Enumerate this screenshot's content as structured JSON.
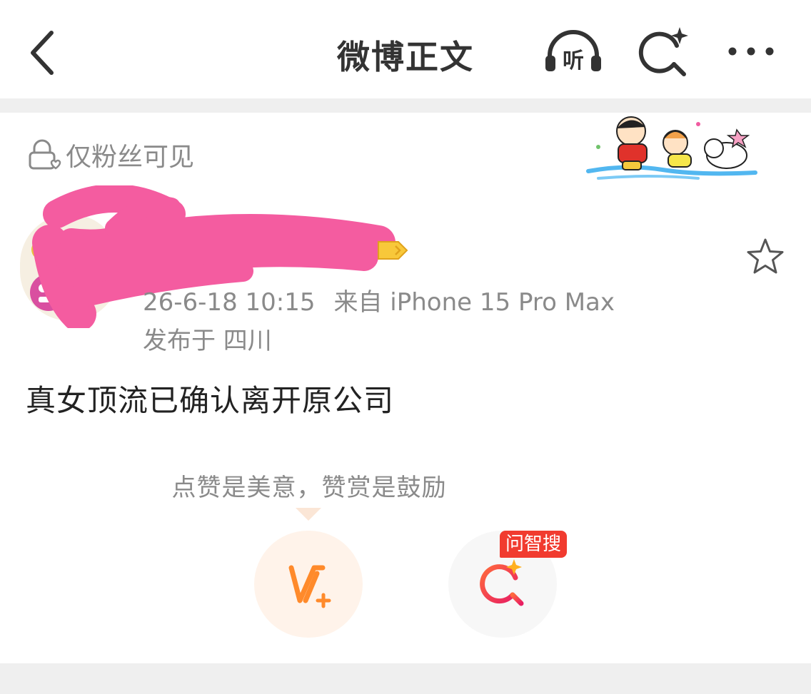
{
  "header": {
    "title": "微博正文",
    "listen_label": "听"
  },
  "post": {
    "visibility": "仅粉丝可见",
    "timestamp": "26-6-18 10:15",
    "source": "来自 iPhone 15 Pro Max",
    "location": "发布于 四川",
    "text": "真女顶流已确认离开原公司"
  },
  "reward": {
    "tip": "点赞是美意，赞赏是鼓励"
  },
  "ask": {
    "tag": "问智搜"
  },
  "colors": {
    "accent_orange": "#ff8a2b",
    "ask_red": "#f13b2f",
    "redaction_pink": "#f45ca0",
    "muted_text": "#8a8a8a"
  }
}
